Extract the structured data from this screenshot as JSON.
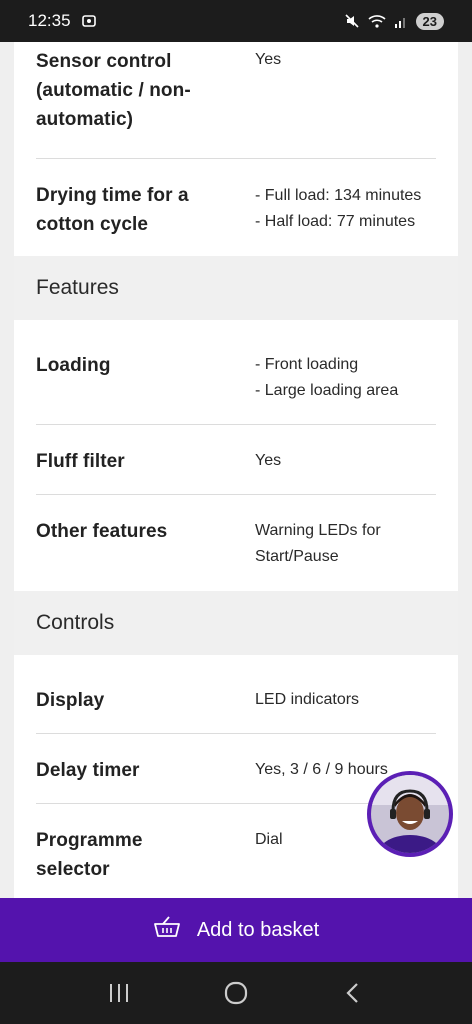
{
  "status_bar": {
    "time": "12:35",
    "battery": "23"
  },
  "specs": [
    {
      "label_lines": [
        "Sensor control",
        "(automatic / non-",
        "automatic)"
      ],
      "value_lines": [
        "Yes"
      ]
    },
    {
      "label_lines": [
        "Drying time for a",
        "cotton cycle"
      ],
      "value_lines": [
        "- Full load: 134 minutes",
        "- Half load: 77 minutes"
      ]
    }
  ],
  "sections": {
    "features": {
      "title": "Features",
      "rows": [
        {
          "label_lines": [
            "Loading"
          ],
          "value_lines": [
            "- Front loading",
            "- Large loading area"
          ]
        },
        {
          "label_lines": [
            "Fluff filter"
          ],
          "value_lines": [
            "Yes"
          ]
        },
        {
          "label_lines": [
            "Other features"
          ],
          "value_lines": [
            "Warning LEDs for",
            "Start/Pause"
          ]
        }
      ]
    },
    "controls": {
      "title": "Controls",
      "rows": [
        {
          "label_lines": [
            "Display"
          ],
          "value_lines": [
            "LED indicators"
          ]
        },
        {
          "label_lines": [
            "Delay timer"
          ],
          "value_lines": [
            "Yes, 3 / 6 / 9 hours"
          ]
        },
        {
          "label_lines": [
            "Programme",
            "selector"
          ],
          "value_lines": [
            "Dial"
          ]
        }
      ]
    }
  },
  "basket": {
    "label": "Add to basket"
  },
  "colors": {
    "accent": "#5413ad",
    "section_bg": "#f0f0f0",
    "status_bg": "#1c1c1c"
  },
  "icons": [
    "mute-icon",
    "wifi-icon",
    "signal-icon",
    "screenshot-icon",
    "basket-icon",
    "recents-icon",
    "home-icon",
    "back-icon"
  ]
}
